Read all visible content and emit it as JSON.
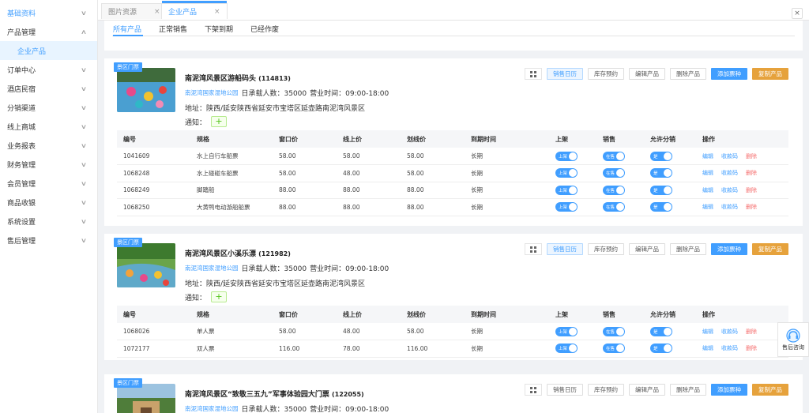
{
  "sidebar": {
    "items": [
      {
        "label": "基础资料"
      },
      {
        "label": "产品管理"
      },
      {
        "label": "企业产品"
      },
      {
        "label": "订单中心"
      },
      {
        "label": "酒店民宿"
      },
      {
        "label": "分销渠道"
      },
      {
        "label": "线上商城"
      },
      {
        "label": "业务报表"
      },
      {
        "label": "财务管理"
      },
      {
        "label": "会员管理"
      },
      {
        "label": "商品收银"
      },
      {
        "label": "系统设置"
      },
      {
        "label": "售后管理"
      }
    ]
  },
  "tabs": [
    {
      "label": "图片资源",
      "close": "×"
    },
    {
      "label": "企业产品",
      "close": "×"
    }
  ],
  "close_all": "×",
  "subtabs": [
    "所有产品",
    "正常销售",
    "下架到期",
    "已经作废"
  ],
  "common": {
    "badge": "景区门票",
    "park_link": "南泥湾国家湿地公园",
    "capacity": "日承载人数：35000",
    "hours": "营业时间：09:00-18:00",
    "address": "地址：陕西/延安陕西省延安市宝塔区延壶路南泥湾风景区",
    "notice_label": "通知：",
    "plus": "+"
  },
  "actions": [
    "销售日历",
    "库存预约",
    "编辑产品",
    "删除产品",
    "添加票种",
    "复制产品"
  ],
  "table_headers": [
    "编号",
    "规格",
    "窗口价",
    "线上价",
    "划线价",
    "到期时间",
    "上架",
    "销售",
    "允许分销",
    "操作"
  ],
  "switch_labels": {
    "on_shelf": "上架",
    "sale": "在售",
    "dist": "是"
  },
  "row_ops": [
    "编辑",
    "收款码",
    "删除"
  ],
  "products": [
    {
      "name": "南泥湾风景区游船码头",
      "id": "(114813)",
      "rows": [
        {
          "code": "1041609",
          "spec": "水上自行车船票",
          "window": "58.00",
          "online": "58.00",
          "strike": "58.00",
          "expire": "长期"
        },
        {
          "code": "1068248",
          "spec": "水上碰碰车船票",
          "window": "58.00",
          "online": "48.00",
          "strike": "58.00",
          "expire": "长期"
        },
        {
          "code": "1068249",
          "spec": "脚踏船",
          "window": "88.00",
          "online": "88.00",
          "strike": "88.00",
          "expire": "长期"
        },
        {
          "code": "1068250",
          "spec": "大黄鸭电动游船船票",
          "window": "88.00",
          "online": "88.00",
          "strike": "88.00",
          "expire": "长期"
        }
      ]
    },
    {
      "name": "南泥湾风景区小溪乐漂",
      "id": "(121982)",
      "rows": [
        {
          "code": "1068026",
          "spec": "单人票",
          "window": "58.00",
          "online": "48.00",
          "strike": "58.00",
          "expire": "长期"
        },
        {
          "code": "1072177",
          "spec": "双人票",
          "window": "116.00",
          "online": "78.00",
          "strike": "116.00",
          "expire": "长期"
        }
      ]
    },
    {
      "name": "南泥湾风景区“致敬三五九”军事体验园大门票",
      "id": "(122055)",
      "rows": []
    }
  ],
  "service_label": "售后咨询",
  "colors": {
    "primary": "#409eff",
    "warning": "#e6a23c",
    "danger": "#f56c6c",
    "success": "#52c41a"
  }
}
